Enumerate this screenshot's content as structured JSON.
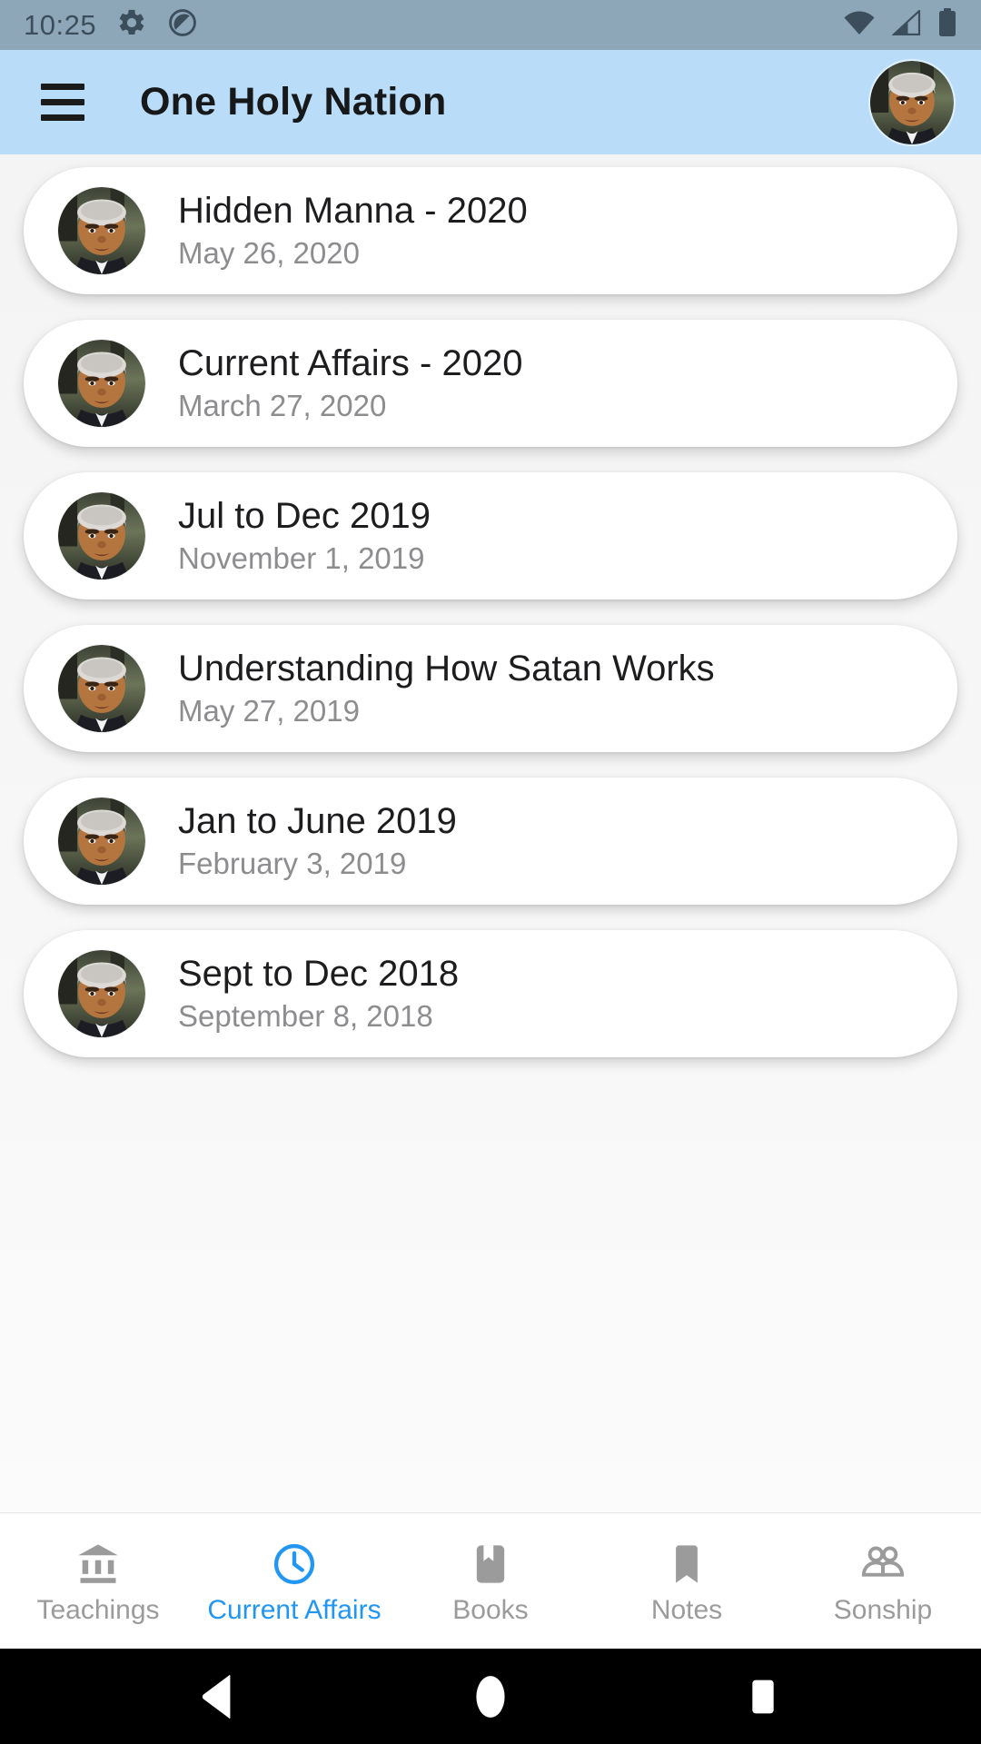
{
  "status_bar": {
    "time": "10:25",
    "left_icons": [
      "gear-icon",
      "do-not-disturb-icon"
    ],
    "right_icons": [
      "wifi-icon",
      "cellular-signal-icon",
      "battery-full-icon"
    ],
    "background_color": "#8ea7b8"
  },
  "app_bar": {
    "title": "One Holy Nation",
    "menu_icon": "hamburger-menu-icon",
    "avatar_icon": "profile-avatar",
    "background_color": "#b9ddf8"
  },
  "list": {
    "items": [
      {
        "title": "Hidden Manna - 2020",
        "date": "May 26, 2020"
      },
      {
        "title": "Current Affairs - 2020",
        "date": "March 27, 2020"
      },
      {
        "title": "Jul to Dec 2019",
        "date": "November 1, 2019"
      },
      {
        "title": "Understanding How Satan Works",
        "date": "May 27, 2019"
      },
      {
        "title": "Jan to June 2019",
        "date": "February 3, 2019"
      },
      {
        "title": "Sept to Dec 2018",
        "date": "September 8, 2018"
      }
    ]
  },
  "bottom_nav": {
    "active_color": "#2196f3",
    "inactive_color": "#9b9b9b",
    "items": [
      {
        "label": "Teachings",
        "icon": "bank-columns-icon",
        "active": false
      },
      {
        "label": "Current Affairs",
        "icon": "clock-icon",
        "active": true
      },
      {
        "label": "Books",
        "icon": "book-icon",
        "active": false
      },
      {
        "label": "Notes",
        "icon": "bookmark-icon",
        "active": false
      },
      {
        "label": "Sonship",
        "icon": "people-icon",
        "active": false
      }
    ]
  },
  "android_nav": {
    "items": [
      {
        "name": "back-button",
        "icon": "triangle-left-icon"
      },
      {
        "name": "home-button",
        "icon": "circle-icon"
      },
      {
        "name": "recents-button",
        "icon": "square-icon"
      }
    ]
  }
}
